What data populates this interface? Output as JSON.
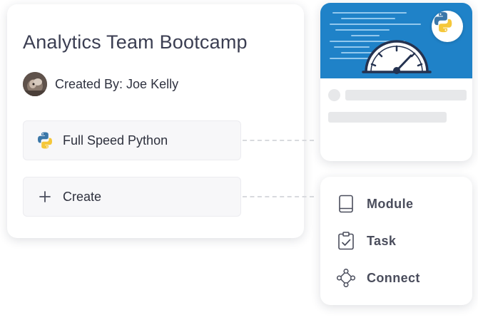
{
  "course": {
    "title": "Analytics Team Bootcamp",
    "created_by": "Created By: Joe Kelly"
  },
  "items": {
    "python_label": "Full Speed Python",
    "create_label": "Create"
  },
  "menu": {
    "module_label": "Module",
    "task_label": "Task",
    "connect_label": "Connect"
  },
  "icons": {
    "python": "python-logo-icon",
    "plus": "plus-icon",
    "module": "book-icon",
    "task": "clipboard-check-icon",
    "connect": "connect-nodes-icon",
    "speedometer": "speedometer-icon"
  },
  "colors": {
    "banner": "#1f82c8",
    "python_blue": "#3b77a8",
    "python_yellow": "#f5c73a"
  }
}
